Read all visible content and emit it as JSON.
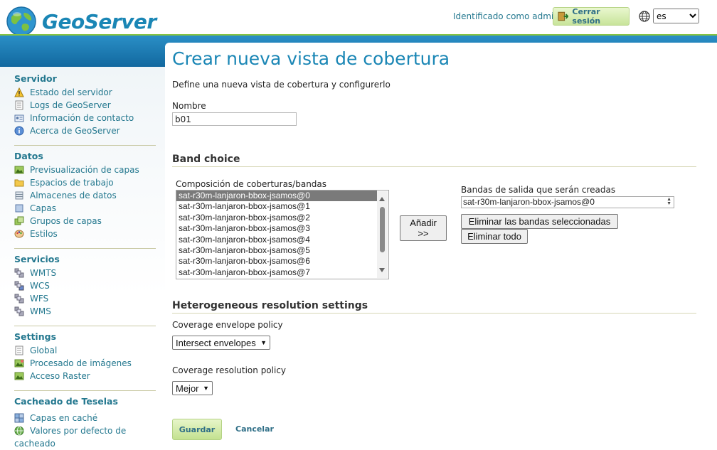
{
  "header": {
    "app_name": "GeoServer",
    "logged_in_text": "Identificado como admin.",
    "logout_label": "Cerrar sesión",
    "language": "es"
  },
  "sidebar": {
    "sections": [
      {
        "title": "Servidor",
        "items": [
          {
            "label": "Estado del servidor",
            "icon": "server-status-icon"
          },
          {
            "label": "Logs de GeoServer",
            "icon": "log-page-icon"
          },
          {
            "label": "Información de contacto",
            "icon": "contact-card-icon"
          },
          {
            "label": "Acerca de GeoServer",
            "icon": "about-info-icon"
          }
        ]
      },
      {
        "title": "Datos",
        "items": [
          {
            "label": "Previsualización de capas",
            "icon": "layer-preview-icon"
          },
          {
            "label": "Espacios de trabajo",
            "icon": "folder-icon"
          },
          {
            "label": "Almacenes de datos",
            "icon": "store-icon"
          },
          {
            "label": "Capas",
            "icon": "layer-icon"
          },
          {
            "label": "Grupos de capas",
            "icon": "layer-group-icon"
          },
          {
            "label": "Estilos",
            "icon": "palette-icon"
          }
        ]
      },
      {
        "title": "Servicios",
        "items": [
          {
            "label": "WMTS",
            "icon": "service-icon"
          },
          {
            "label": "WCS",
            "icon": "service-icon"
          },
          {
            "label": "WFS",
            "icon": "service-icon"
          },
          {
            "label": "WMS",
            "icon": "service-icon"
          }
        ]
      },
      {
        "title": "Settings",
        "items": [
          {
            "label": "Global",
            "icon": "global-settings-icon"
          },
          {
            "label": "Procesado de imágenes",
            "icon": "image-processing-icon"
          },
          {
            "label": "Acceso Raster",
            "icon": "raster-access-icon"
          }
        ]
      },
      {
        "title": "Cacheado de Teselas",
        "items": [
          {
            "label": "Capas en caché",
            "icon": "tile-grid-icon"
          },
          {
            "label": "Valores por defecto de cacheado",
            "icon": "globe-icon"
          }
        ]
      }
    ]
  },
  "main": {
    "title": "Crear nueva vista de cobertura",
    "subtitle": "Define una nueva vista de cobertura y configurerlo",
    "name_label": "Nombre",
    "name_value": "b01",
    "band_choice_heading": "Band choice",
    "composition_label": "Composición de coberturas/bandas",
    "bands": [
      "sat-r30m-lanjaron-bbox-jsamos@0",
      "sat-r30m-lanjaron-bbox-jsamos@1",
      "sat-r30m-lanjaron-bbox-jsamos@2",
      "sat-r30m-lanjaron-bbox-jsamos@3",
      "sat-r30m-lanjaron-bbox-jsamos@4",
      "sat-r30m-lanjaron-bbox-jsamos@5",
      "sat-r30m-lanjaron-bbox-jsamos@6",
      "sat-r30m-lanjaron-bbox-jsamos@7"
    ],
    "add_label_line1": "Añadir",
    "add_label_line2": ">>",
    "output_label": "Bandas de salida que serán creadas",
    "output_value": "sat-r30m-lanjaron-bbox-jsamos@0",
    "remove_selected_label": "Eliminar las bandas seleccionadas",
    "remove_all_label": "Eliminar todo",
    "hetero_heading": "Heterogeneous resolution settings",
    "envelope_label": "Coverage envelope policy",
    "envelope_value": "Intersect envelopes",
    "resolution_label": "Coverage resolution policy",
    "resolution_value": "Mejor",
    "save_label": "Guardar",
    "cancel_label": "Cancelar"
  }
}
